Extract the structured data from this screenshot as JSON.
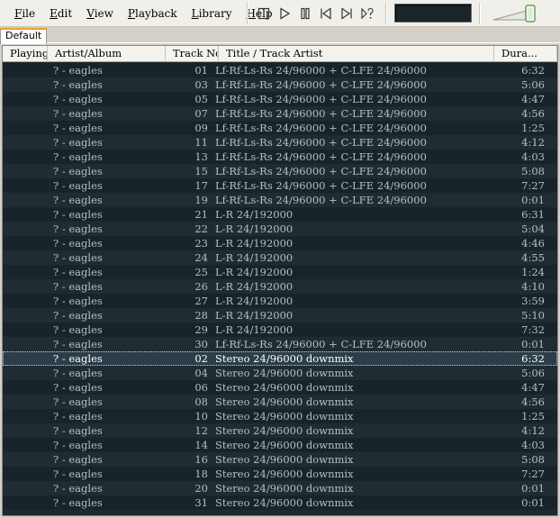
{
  "menu": [
    "File",
    "Edit",
    "View",
    "Playback",
    "Library",
    "Help"
  ],
  "controls": [
    "stop-icon",
    "play-icon",
    "pause-icon",
    "previous-icon",
    "next-icon",
    "random-icon"
  ],
  "tabs": [
    "Default"
  ],
  "columns": [
    "Playing",
    "Artist/Album",
    "Track No",
    "Title / Track Artist",
    "Dura..."
  ],
  "selected_index": 20,
  "rows": [
    {
      "artist": "? - eagles",
      "track": "01",
      "title": "Lf-Rf-Ls-Rs 24/96000 + C-LFE 24/96000",
      "duration": "6:32"
    },
    {
      "artist": "? - eagles",
      "track": "03",
      "title": "Lf-Rf-Ls-Rs 24/96000 + C-LFE 24/96000",
      "duration": "5:06"
    },
    {
      "artist": "? - eagles",
      "track": "05",
      "title": "Lf-Rf-Ls-Rs 24/96000 + C-LFE 24/96000",
      "duration": "4:47"
    },
    {
      "artist": "? - eagles",
      "track": "07",
      "title": "Lf-Rf-Ls-Rs 24/96000 + C-LFE 24/96000",
      "duration": "4:56"
    },
    {
      "artist": "? - eagles",
      "track": "09",
      "title": "Lf-Rf-Ls-Rs 24/96000 + C-LFE 24/96000",
      "duration": "1:25"
    },
    {
      "artist": "? - eagles",
      "track": "11",
      "title": "Lf-Rf-Ls-Rs 24/96000 + C-LFE 24/96000",
      "duration": "4:12"
    },
    {
      "artist": "? - eagles",
      "track": "13",
      "title": "Lf-Rf-Ls-Rs 24/96000 + C-LFE 24/96000",
      "duration": "4:03"
    },
    {
      "artist": "? - eagles",
      "track": "15",
      "title": "Lf-Rf-Ls-Rs 24/96000 + C-LFE 24/96000",
      "duration": "5:08"
    },
    {
      "artist": "? - eagles",
      "track": "17",
      "title": "Lf-Rf-Ls-Rs 24/96000 + C-LFE 24/96000",
      "duration": "7:27"
    },
    {
      "artist": "? - eagles",
      "track": "19",
      "title": "Lf-Rf-Ls-Rs 24/96000 + C-LFE 24/96000",
      "duration": "0:01"
    },
    {
      "artist": "? - eagles",
      "track": "21",
      "title": "L-R 24/192000",
      "duration": "6:31"
    },
    {
      "artist": "? - eagles",
      "track": "22",
      "title": "L-R 24/192000",
      "duration": "5:04"
    },
    {
      "artist": "? - eagles",
      "track": "23",
      "title": "L-R 24/192000",
      "duration": "4:46"
    },
    {
      "artist": "? - eagles",
      "track": "24",
      "title": "L-R 24/192000",
      "duration": "4:55"
    },
    {
      "artist": "? - eagles",
      "track": "25",
      "title": "L-R 24/192000",
      "duration": "1:24"
    },
    {
      "artist": "? - eagles",
      "track": "26",
      "title": "L-R 24/192000",
      "duration": "4:10"
    },
    {
      "artist": "? - eagles",
      "track": "27",
      "title": "L-R 24/192000",
      "duration": "3:59"
    },
    {
      "artist": "? - eagles",
      "track": "28",
      "title": "L-R 24/192000",
      "duration": "5:10"
    },
    {
      "artist": "? - eagles",
      "track": "29",
      "title": "L-R 24/192000",
      "duration": "7:32"
    },
    {
      "artist": "? - eagles",
      "track": "30",
      "title": "Lf-Rf-Ls-Rs 24/96000 + C-LFE 24/96000",
      "duration": "0:01"
    },
    {
      "artist": "? - eagles",
      "track": "02",
      "title": "Stereo 24/96000 downmix",
      "duration": "6:32"
    },
    {
      "artist": "? - eagles",
      "track": "04",
      "title": "Stereo 24/96000 downmix",
      "duration": "5:06"
    },
    {
      "artist": "? - eagles",
      "track": "06",
      "title": "Stereo 24/96000 downmix",
      "duration": "4:47"
    },
    {
      "artist": "? - eagles",
      "track": "08",
      "title": "Stereo 24/96000 downmix",
      "duration": "4:56"
    },
    {
      "artist": "? - eagles",
      "track": "10",
      "title": "Stereo 24/96000 downmix",
      "duration": "1:25"
    },
    {
      "artist": "? - eagles",
      "track": "12",
      "title": "Stereo 24/96000 downmix",
      "duration": "4:12"
    },
    {
      "artist": "? - eagles",
      "track": "14",
      "title": "Stereo 24/96000 downmix",
      "duration": "4:03"
    },
    {
      "artist": "? - eagles",
      "track": "16",
      "title": "Stereo 24/96000 downmix",
      "duration": "5:08"
    },
    {
      "artist": "? - eagles",
      "track": "18",
      "title": "Stereo 24/96000 downmix",
      "duration": "7:27"
    },
    {
      "artist": "? - eagles",
      "track": "20",
      "title": "Stereo 24/96000 downmix",
      "duration": "0:01"
    },
    {
      "artist": "? - eagles",
      "track": "31",
      "title": "Stereo 24/96000 downmix",
      "duration": "0:01"
    }
  ],
  "colors": {
    "list_bg": "#1d2a30",
    "text": "#b7bec1",
    "selected_text": "#ffffff",
    "tab_accent": "#f0a020"
  }
}
